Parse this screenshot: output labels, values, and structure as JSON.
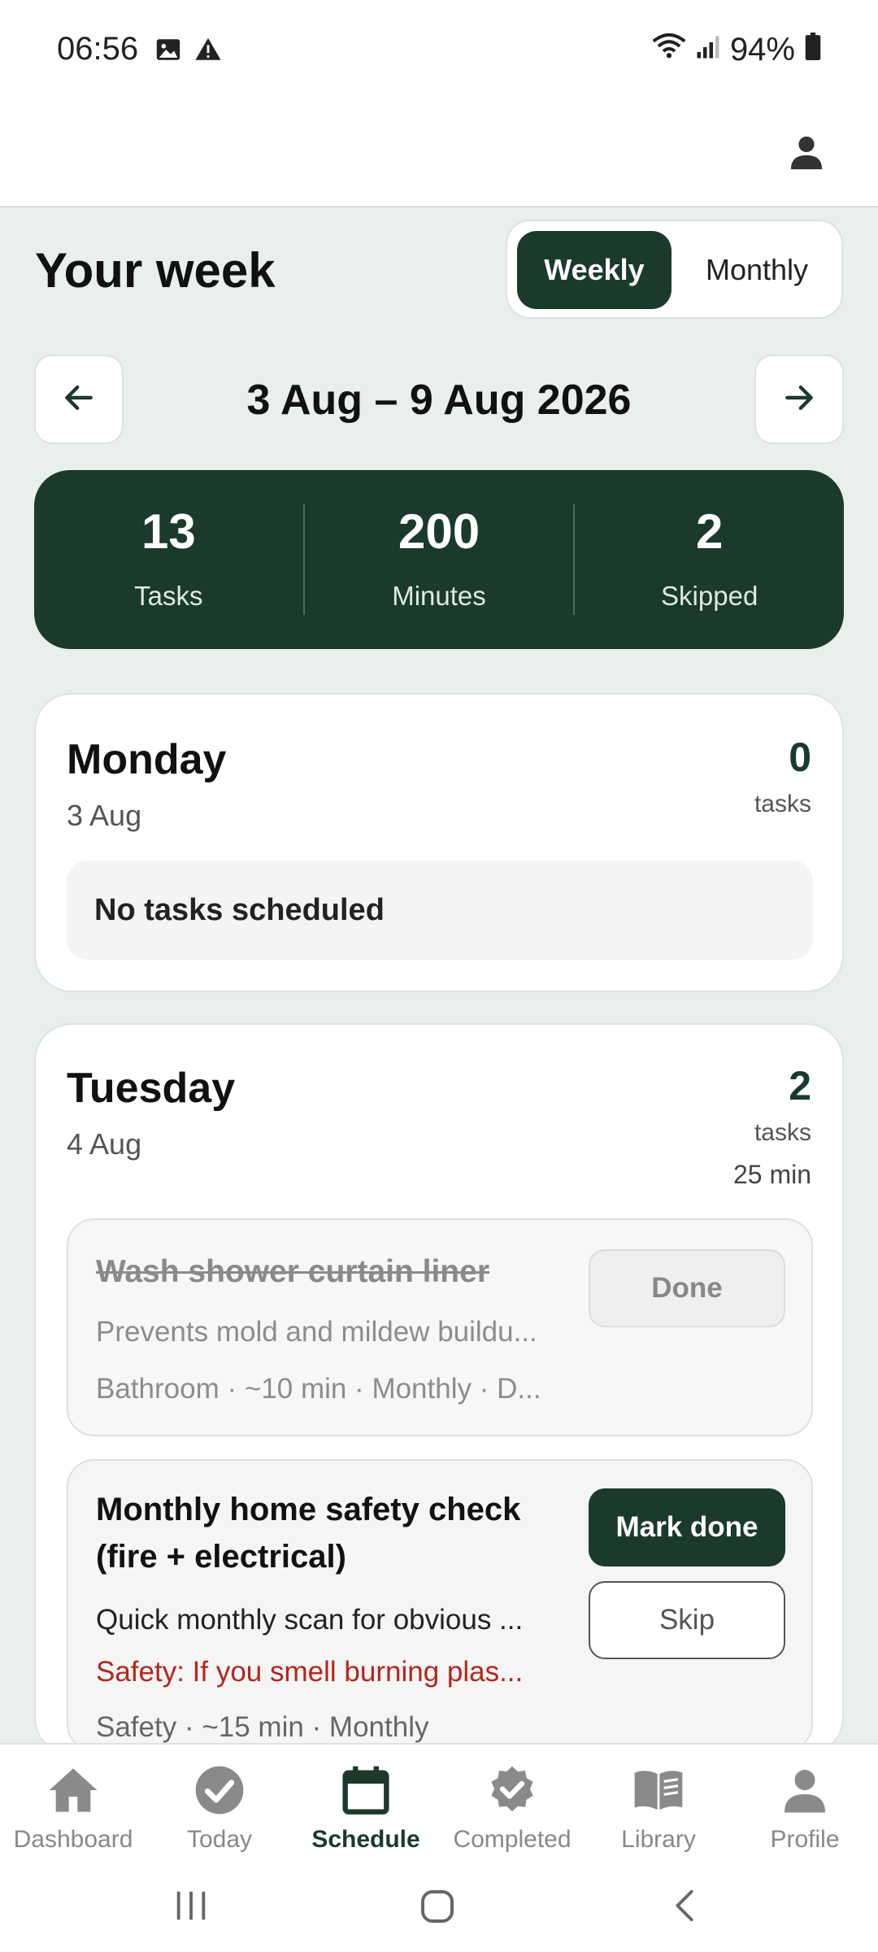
{
  "status_bar": {
    "time": "06:56",
    "battery": "94%",
    "icons": [
      "image-icon",
      "warning-icon",
      "wifi-icon",
      "signal-icon",
      "battery-icon"
    ]
  },
  "header": {
    "title": "Your week",
    "toggle": {
      "weekly": "Weekly",
      "monthly": "Monthly",
      "selected": "Weekly"
    }
  },
  "week": {
    "range": "3 Aug – 9 Aug 2026"
  },
  "stats": [
    {
      "value": "13",
      "label": "Tasks"
    },
    {
      "value": "200",
      "label": "Minutes"
    },
    {
      "value": "2",
      "label": "Skipped"
    }
  ],
  "days": {
    "monday": {
      "name": "Monday",
      "date": "3 Aug",
      "count": "0",
      "count_label": "tasks",
      "empty": "No tasks scheduled"
    },
    "tuesday": {
      "name": "Tuesday",
      "date": "4 Aug",
      "count": "2",
      "count_label": "tasks",
      "minutes": "25 min",
      "tasks": [
        {
          "title": "Wash shower curtain liner",
          "description": "Prevents mold and mildew buildu...",
          "meta": "Bathroom · ~10 min · Monthly · D...",
          "status": "done",
          "done_label": "Done"
        },
        {
          "title_line1": "Monthly home safety check",
          "title_line2": "(fire + electrical)",
          "description": "Quick monthly scan for obvious ...",
          "warning": "Safety: If you smell burning plas...",
          "meta": "Safety · ~15 min · Monthly",
          "status": "open",
          "mark_done_label": "Mark done",
          "skip_label": "Skip"
        }
      ]
    }
  },
  "bottom_nav": [
    {
      "label": "Dashboard",
      "icon": "home-icon"
    },
    {
      "label": "Today",
      "icon": "check-circle-icon"
    },
    {
      "label": "Schedule",
      "icon": "calendar-icon",
      "active": true
    },
    {
      "label": "Completed",
      "icon": "badge-check-icon"
    },
    {
      "label": "Library",
      "icon": "book-icon"
    },
    {
      "label": "Profile",
      "icon": "person-icon"
    }
  ],
  "colors": {
    "accent": "#1b3a2c",
    "background": "#e9efeb",
    "warning_text": "#b3261e"
  }
}
